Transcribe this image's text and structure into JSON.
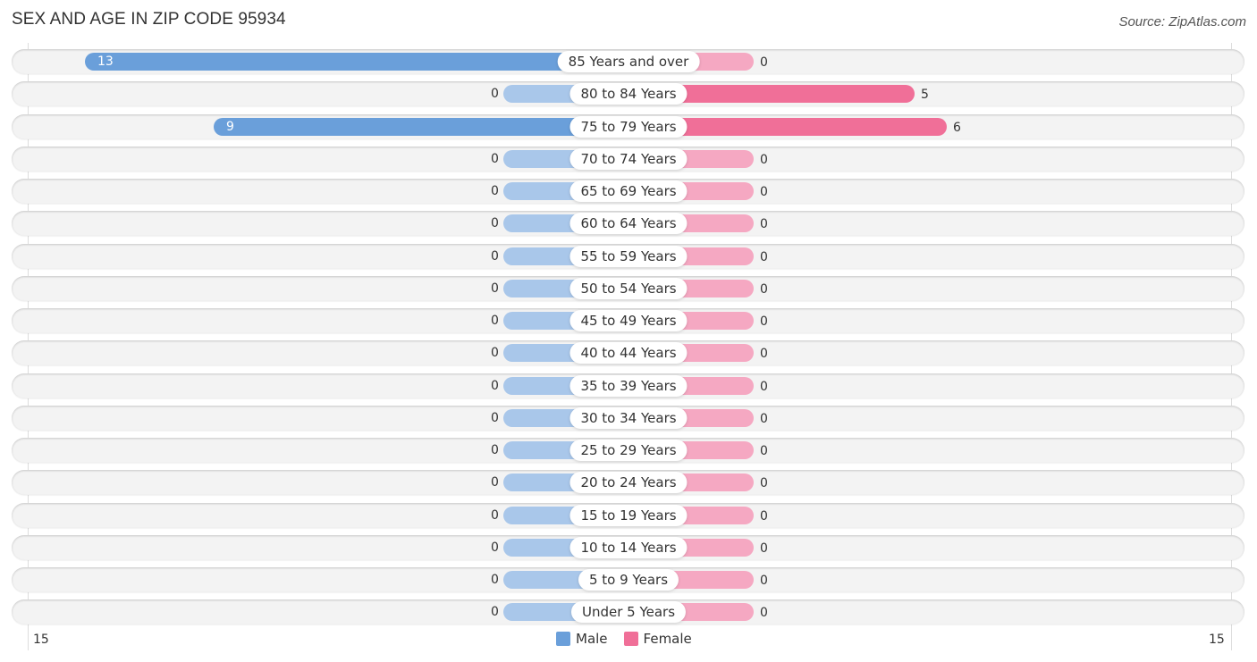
{
  "header": {
    "title": "SEX AND AGE IN ZIP CODE 95934",
    "source": "Source: ZipAtlas.com"
  },
  "colors": {
    "male": "#6a9fda",
    "male_zero": "#a9c7ea",
    "female": "#f06f98",
    "female_zero": "#f5a8c2"
  },
  "chart_data": {
    "type": "bar",
    "orientation": "horizontal-diverging",
    "title": "SEX AND AGE IN ZIP CODE 95934",
    "categories": [
      "85 Years and over",
      "80 to 84 Years",
      "75 to 79 Years",
      "70 to 74 Years",
      "65 to 69 Years",
      "60 to 64 Years",
      "55 to 59 Years",
      "50 to 54 Years",
      "45 to 49 Years",
      "40 to 44 Years",
      "35 to 39 Years",
      "30 to 34 Years",
      "25 to 29 Years",
      "20 to 24 Years",
      "15 to 19 Years",
      "10 to 14 Years",
      "5 to 9 Years",
      "Under 5 Years"
    ],
    "series": [
      {
        "name": "Male",
        "values": [
          13,
          0,
          9,
          0,
          0,
          0,
          0,
          0,
          0,
          0,
          0,
          0,
          0,
          0,
          0,
          0,
          0,
          0
        ]
      },
      {
        "name": "Female",
        "values": [
          0,
          5,
          6,
          0,
          0,
          0,
          0,
          0,
          0,
          0,
          0,
          0,
          0,
          0,
          0,
          0,
          0,
          0
        ]
      }
    ],
    "axis": {
      "left_tick": "15",
      "right_tick": "15",
      "range": [
        -15,
        15
      ]
    },
    "legend": {
      "position": "bottom-center",
      "entries": [
        "Male",
        "Female"
      ]
    }
  }
}
